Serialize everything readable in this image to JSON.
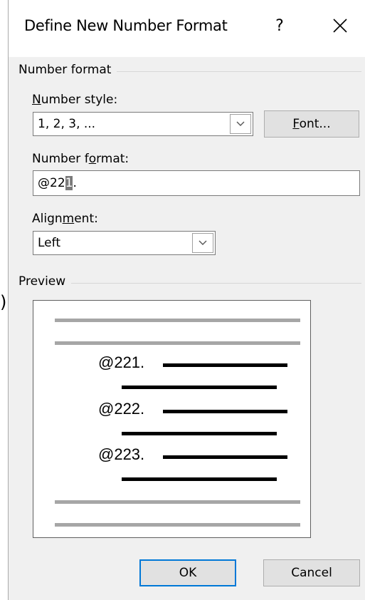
{
  "dialog": {
    "title": "Define New Number Format",
    "help_label": "?",
    "close_icon": "close-icon"
  },
  "number_format_group": {
    "label": "Number format",
    "number_style": {
      "label_pre": "",
      "label_mnemonic": "N",
      "label_post": "umber style:",
      "value": "1, 2, 3, ..."
    },
    "font_button": {
      "mnemonic": "F",
      "rest": "ont..."
    },
    "number_format": {
      "label_pre": "Number f",
      "label_mnemonic": "o",
      "label_post": "rmat:",
      "value_before": "@22",
      "value_selected": "1",
      "value_after": "."
    },
    "alignment": {
      "label_pre": "Align",
      "label_mnemonic": "m",
      "label_post": "ent:",
      "value": "Left"
    }
  },
  "preview_group": {
    "label": "Preview",
    "items": [
      "@221.",
      "@222.",
      "@223."
    ]
  },
  "buttons": {
    "ok": "OK",
    "cancel": "Cancel"
  },
  "colors": {
    "dialog_bg": "#f0f0f0",
    "default_button_border": "#0078d7",
    "preview_gray_line": "#a6a6a6"
  }
}
